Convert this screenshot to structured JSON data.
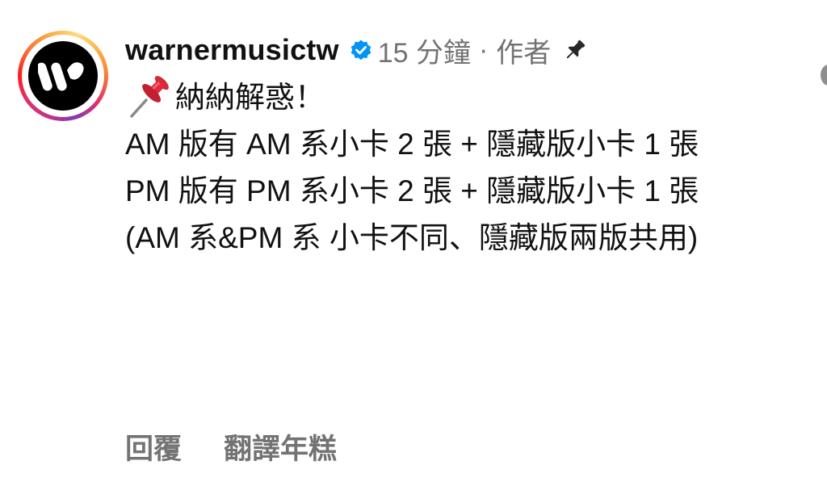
{
  "post": {
    "username": "warnermusictw",
    "time": "15 分鐘",
    "separator": "·",
    "author_tag": "作者",
    "lines": [
      "納納解惑！",
      "AM 版有 AM 系小卡 2 張 + 隱藏版小卡 1 張",
      "PM 版有 PM 系小卡 2 張 + 隱藏版小卡 1 張",
      "(AM 系&PM 系 小卡不同、隱藏版兩版共用)"
    ]
  },
  "actions": {
    "reply": "回覆",
    "translate": "翻譯年糕"
  },
  "icons": {
    "avatar": "warner-music-logo-icon",
    "verified": "verified-badge-icon",
    "pin": "pin-icon",
    "pushpin": "pushpin-emoji-icon"
  },
  "colors": {
    "verified": "#0095f6",
    "meta": "#737373",
    "pushpin": "#e0245e"
  }
}
